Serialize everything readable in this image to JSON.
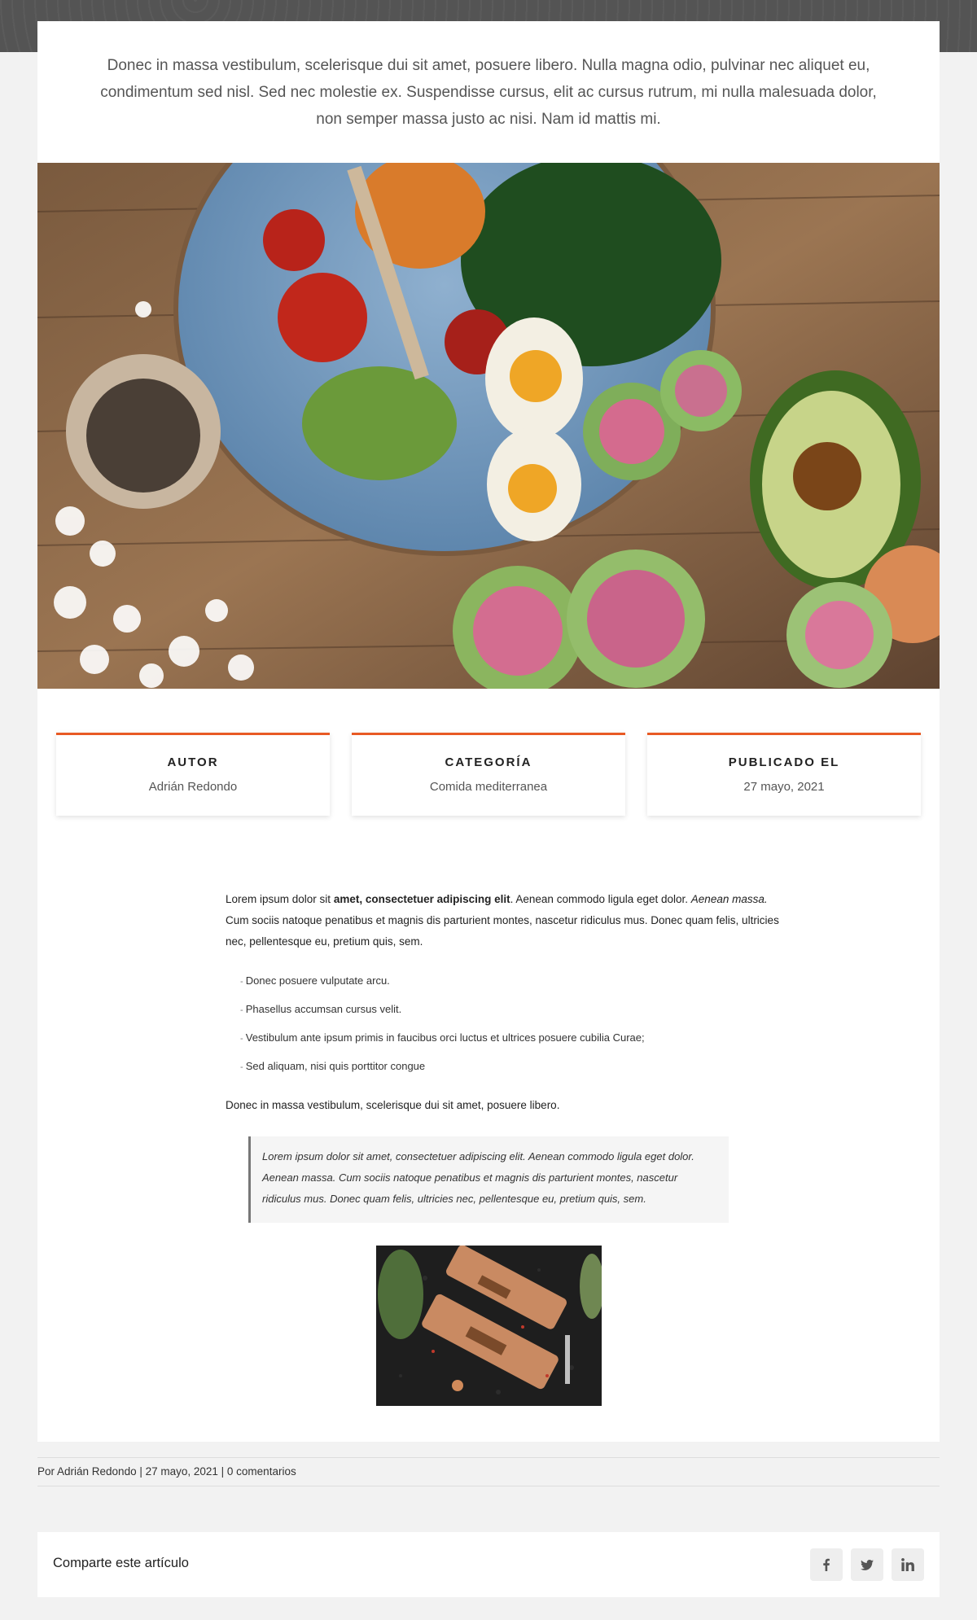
{
  "intro": {
    "text": "Donec in massa vestibulum, scelerisque dui sit amet, posuere libero. Nulla magna odio, pulvinar nec aliquet eu, condimentum sed nisl. Sed nec molestie ex. Suspendisse cursus, elit ac cursus rutrum, mi nulla malesuada dolor, non semper massa justo ac nisi. Nam id mattis mi."
  },
  "meta": [
    {
      "label": "AUTOR",
      "value": "Adrián Redondo"
    },
    {
      "label": "CATEGORÍA",
      "value": "Comida mediterranea"
    },
    {
      "label": "PUBLICADO EL",
      "value": "27 mayo, 2021"
    }
  ],
  "article": {
    "p1_a": "Lorem ipsum dolor sit ",
    "p1_bold": "amet, consectetuer adipiscing elit",
    "p1_b": ". Aenean commodo ligula eget dolor. ",
    "p1_italic": "Aenean massa.",
    "p1_c": " Cum sociis natoque penatibus et magnis dis parturient montes, nascetur ridiculus mus. Donec quam felis, ultricies nec, pellentesque eu, pretium quis, sem.",
    "list": [
      "Donec posuere vulputate arcu.",
      "Phasellus accumsan cursus velit.",
      "Vestibulum ante ipsum primis in faucibus orci luctus et ultrices posuere cubilia Curae;",
      "Sed aliquam, nisi quis porttitor congue"
    ],
    "p2": "Donec in massa vestibulum, scelerisque dui sit amet, posuere libero.",
    "quote": "Lorem ipsum dolor sit amet, consectetuer adipiscing elit. Aenean commodo ligula eget dolor. Aenean massa. Cum sociis natoque penatibus et magnis dis parturient montes, nascetur ridiculus mus. Donec quam felis, ultricies nec, pellentesque eu, pretium quis, sem."
  },
  "byline": {
    "text": "Por Adrián Redondo | 27 mayo, 2021 | 0 comentarios"
  },
  "share": {
    "label": "Comparte este artículo",
    "icons": [
      "facebook-icon",
      "twitter-icon",
      "linkedin-icon"
    ]
  },
  "colors": {
    "accent": "#e85a24",
    "background": "#f2f2f2",
    "top_band": "#545454"
  }
}
